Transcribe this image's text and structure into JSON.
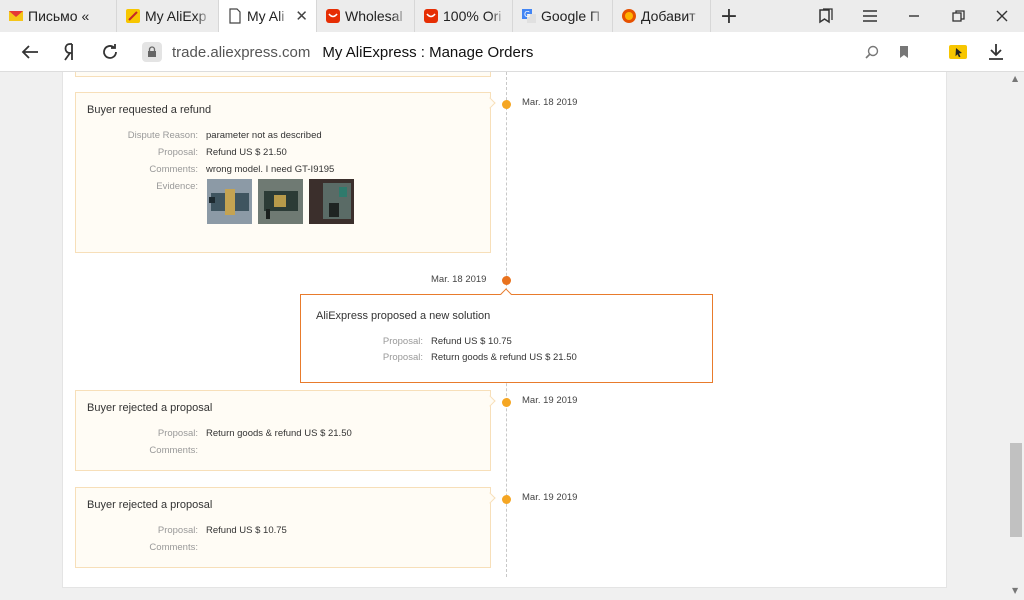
{
  "tabs": [
    {
      "label": "Письмо «",
      "icon": "mail-icon"
    },
    {
      "label": "My AliExp",
      "icon": "aliexpress-icon"
    },
    {
      "label": "My Ali",
      "icon": "page-icon"
    },
    {
      "label": "Wholesal",
      "icon": "aliexpress-icon"
    },
    {
      "label": "100% Ori",
      "icon": "aliexpress-icon"
    },
    {
      "label": "Google П",
      "icon": "google-translate-icon"
    },
    {
      "label": "Добавит",
      "icon": "extension-icon"
    }
  ],
  "address": {
    "domain": "trade.aliexpress.com",
    "title": "My AliExpress : Manage Orders"
  },
  "timeline": {
    "top_card": {
      "text": ""
    },
    "refund": {
      "title": "Buyer requested a refund",
      "date": "Mar. 18 2019",
      "dispute_reason_label": "Dispute Reason:",
      "dispute_reason": "parameter not as described",
      "proposal_label": "Proposal:",
      "proposal": "Refund US $ 21.50",
      "comments_label": "Comments:",
      "comments": "wrong model. I need GT-I9195",
      "evidence_label": "Evidence:"
    },
    "solution": {
      "title": "AliExpress proposed a new solution",
      "date": "Mar. 18 2019",
      "proposal_label": "Proposal:",
      "proposal1": "Refund US $ 10.75",
      "proposal2": "Return goods & refund US $ 21.50"
    },
    "reject1": {
      "title": "Buyer rejected a proposal",
      "date": "Mar. 19 2019",
      "proposal_label": "Proposal:",
      "proposal": "Return goods & refund US $ 21.50",
      "comments_label": "Comments:",
      "comments": ""
    },
    "reject2": {
      "title": "Buyer rejected a proposal",
      "date": "Mar. 19 2019",
      "proposal_label": "Proposal:",
      "proposal": "Refund US $ 10.75",
      "comments_label": "Comments:",
      "comments": ""
    }
  },
  "colors": {
    "accent": "#e9731e",
    "dot": "#f5a623",
    "card_bg": "#fffcf5",
    "card_border": "#f7dfb9"
  }
}
